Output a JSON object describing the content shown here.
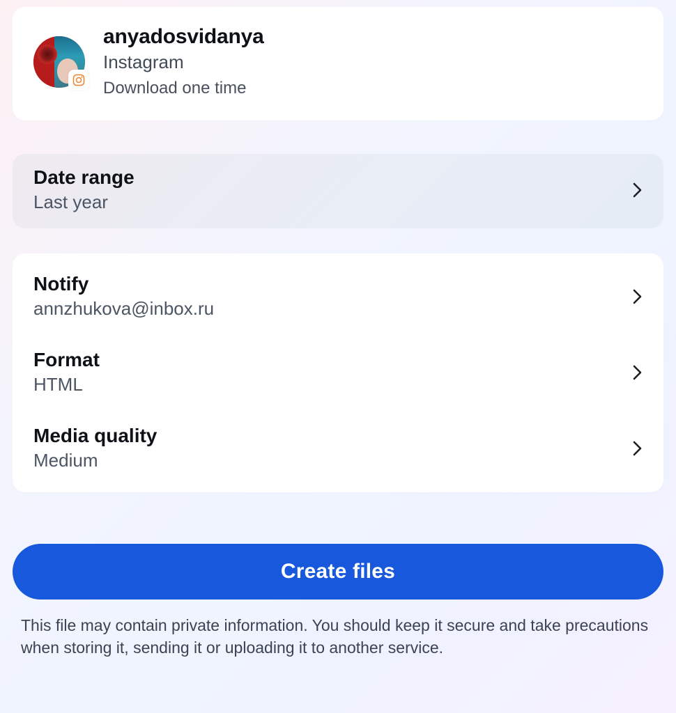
{
  "profile": {
    "username": "anyadosvidanya",
    "platform": "Instagram",
    "download_note": "Download one time"
  },
  "date_range": {
    "title": "Date range",
    "value": "Last year"
  },
  "settings": {
    "notify": {
      "title": "Notify",
      "value": "annzhukova@inbox.ru"
    },
    "format": {
      "title": "Format",
      "value": "HTML"
    },
    "media_quality": {
      "title": "Media quality",
      "value": "Medium"
    }
  },
  "create_button_label": "Create files",
  "disclaimer": "This file may contain private information. You should keep it secure and take precautions when storing it, sending it or uploading it to another service."
}
